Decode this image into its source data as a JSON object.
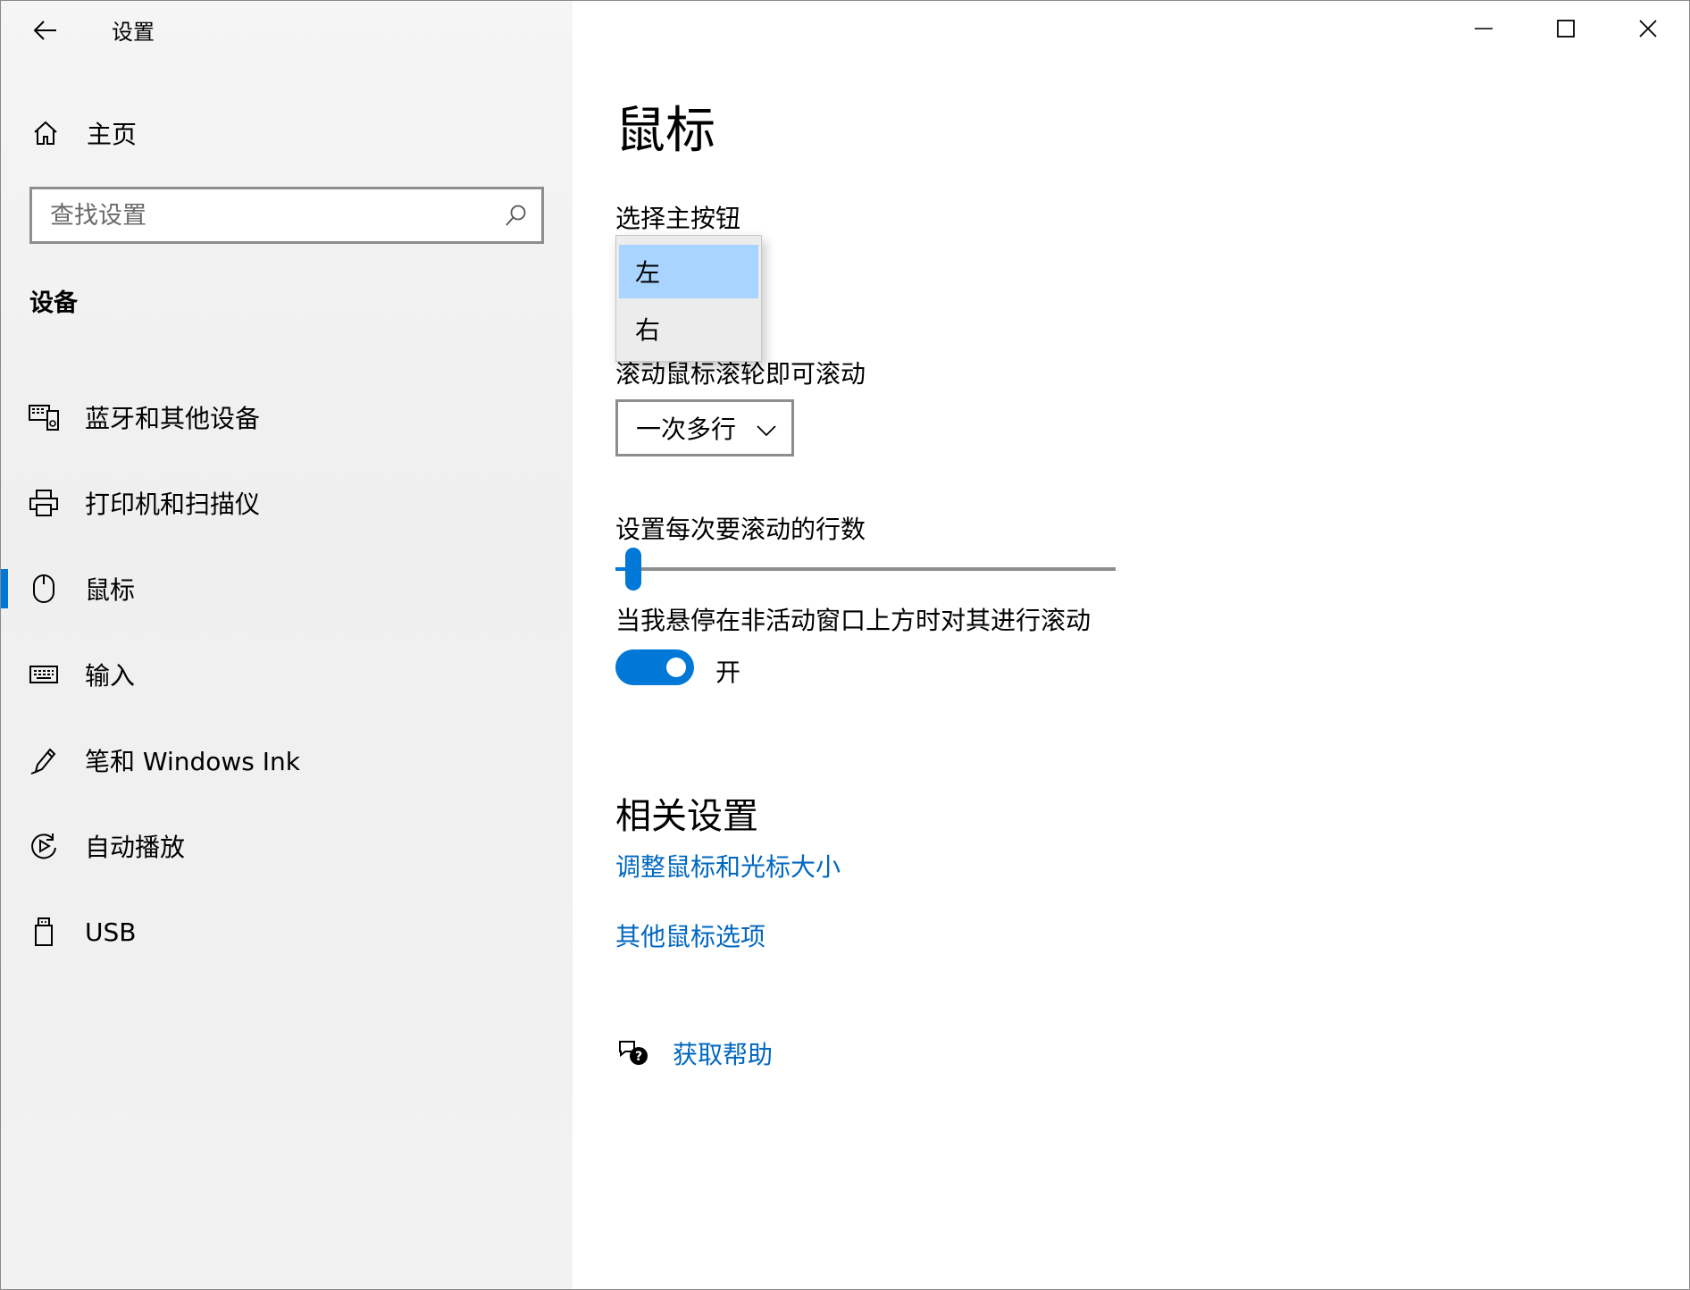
{
  "window": {
    "title": "设置",
    "back_icon": "back-arrow-icon",
    "caption_icons": [
      "minimize-icon",
      "maximize-icon",
      "close-icon"
    ]
  },
  "sidebar": {
    "home_label": "主页",
    "search_placeholder": "查找设置",
    "section_title": "设备",
    "items": [
      {
        "label": "蓝牙和其他设备",
        "icon": "bluetooth-devices-icon"
      },
      {
        "label": "打印机和扫描仪",
        "icon": "printer-icon"
      },
      {
        "label": "鼠标",
        "icon": "mouse-icon",
        "active": true
      },
      {
        "label": "输入",
        "icon": "keyboard-icon"
      },
      {
        "label": "笔和 Windows Ink",
        "icon": "pen-icon"
      },
      {
        "label": "自动播放",
        "icon": "autoplay-icon"
      },
      {
        "label": "USB",
        "icon": "usb-icon"
      }
    ]
  },
  "main": {
    "title": "鼠标",
    "primary_button": {
      "label": "选择主按钮",
      "options": [
        "左",
        "右"
      ],
      "selected": "左"
    },
    "wheel_scroll": {
      "label": "滚动鼠标滚轮即可滚动",
      "value": "一次多行"
    },
    "lines_to_scroll": {
      "label": "设置每次要滚动的行数",
      "value_fraction": 0.02
    },
    "inactive_scroll": {
      "label": "当我悬停在非活动窗口上方时对其进行滚动",
      "state_label": "开",
      "on": true
    },
    "related": {
      "title": "相关设置",
      "links": [
        "调整鼠标和光标大小",
        "其他鼠标选项"
      ]
    },
    "help_label": "获取帮助"
  },
  "colors": {
    "accent": "#0078d7",
    "link": "#0067c0",
    "selected_option": "#a8d4ff"
  }
}
